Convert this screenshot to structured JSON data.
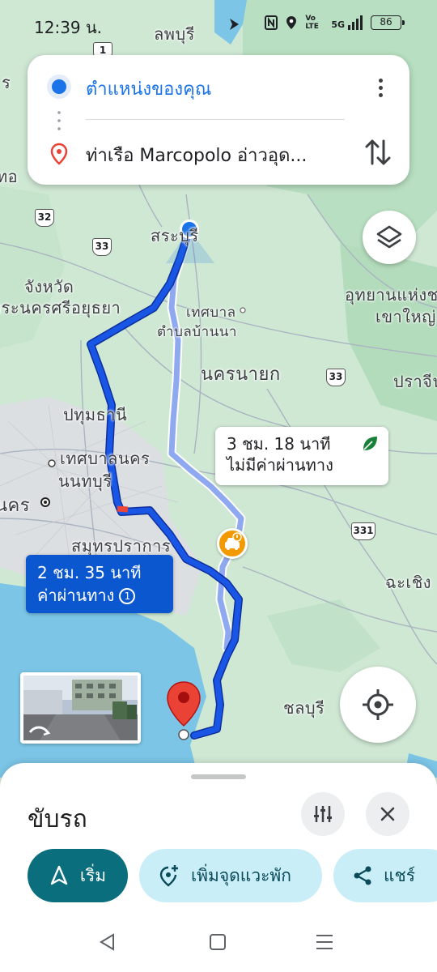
{
  "status_bar": {
    "time": "12:39 น.",
    "network": "5G",
    "volte": "Vo LTE",
    "battery": "86"
  },
  "directions": {
    "origin": "ตำแหน่งของคุณ",
    "destination": "ท่าเรือ Marcopolo อ่าวอุด..."
  },
  "map": {
    "places": [
      {
        "text": "ลพบุรี"
      },
      {
        "text": "สระบุรี"
      },
      {
        "text": "จังหวัด"
      },
      {
        "text": "พระนครศรีอยุธยา"
      },
      {
        "text": "เทศบาล"
      },
      {
        "text": "ตำบลบ้านนา"
      },
      {
        "text": "นครนายก"
      },
      {
        "text": "อุทยานแห่งชาติ"
      },
      {
        "text": "เขาใหญ่"
      },
      {
        "text": "ปราจีน"
      },
      {
        "text": "ปทุมธานี"
      },
      {
        "text": "เทศบาลนคร"
      },
      {
        "text": "นนทบุรี"
      },
      {
        "text": "นคร"
      },
      {
        "text": "สมุทรปราการ"
      },
      {
        "text": "ฉะเชิง"
      },
      {
        "text": "ชลบุรี"
      },
      {
        "text": "ร"
      },
      {
        "text": "ทอ"
      }
    ],
    "route_shields": [
      "1",
      "32",
      "33",
      "33",
      "331"
    ]
  },
  "routes": {
    "alternative": {
      "duration": "3 ชม. 18 นาที",
      "toll": "ไม่มีค่าผ่านทาง"
    },
    "selected": {
      "duration": "2 ชม. 35 นาที",
      "toll": "ค่าผ่านทาง",
      "toll_badge": "1"
    }
  },
  "sheet": {
    "mode": "ขับรถ",
    "buttons": {
      "start": "เริ่ม",
      "add_stop": "เพิ่มจุดแวะพัก",
      "share": "แชร์"
    }
  },
  "colors": {
    "route_selected": "#1a56e6",
    "route_alt": "#8fa9f0",
    "start_chip": "#0b6e7d",
    "chip_secondary": "#c9eef8"
  }
}
